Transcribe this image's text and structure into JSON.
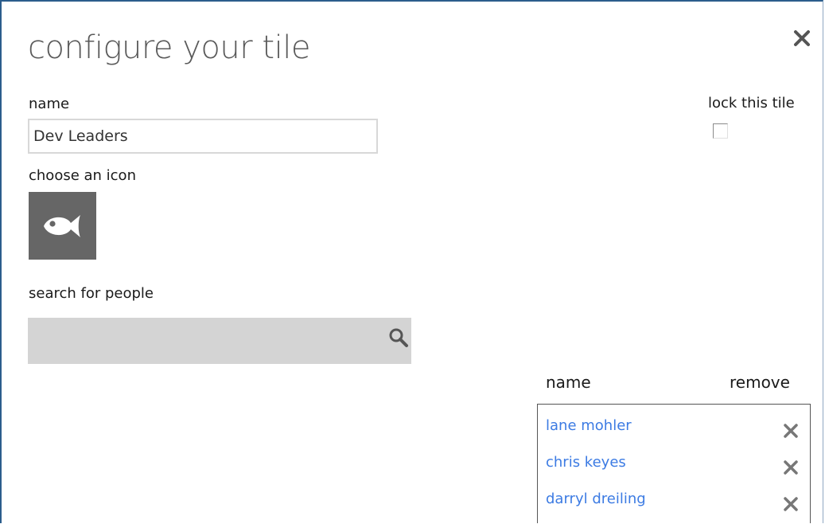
{
  "dialog": {
    "title": "configure your tile",
    "close_icon": "close-icon"
  },
  "name_field": {
    "label": "name",
    "value": "Dev Leaders"
  },
  "lock": {
    "label": "lock this tile",
    "checked": false
  },
  "icon_picker": {
    "label": "choose an icon",
    "selected_icon": "fish-icon"
  },
  "search": {
    "label": "search for people",
    "value": "",
    "icon": "search-icon"
  },
  "people": {
    "name_header": "name",
    "remove_header": "remove",
    "items": [
      {
        "name": "lane mohler"
      },
      {
        "name": "chris keyes"
      },
      {
        "name": "darryl dreiling"
      }
    ]
  },
  "colors": {
    "accent_border": "#2b5d8c",
    "link": "#3c7be3",
    "tile": "#666666",
    "search_bg": "#d4d4d4"
  }
}
